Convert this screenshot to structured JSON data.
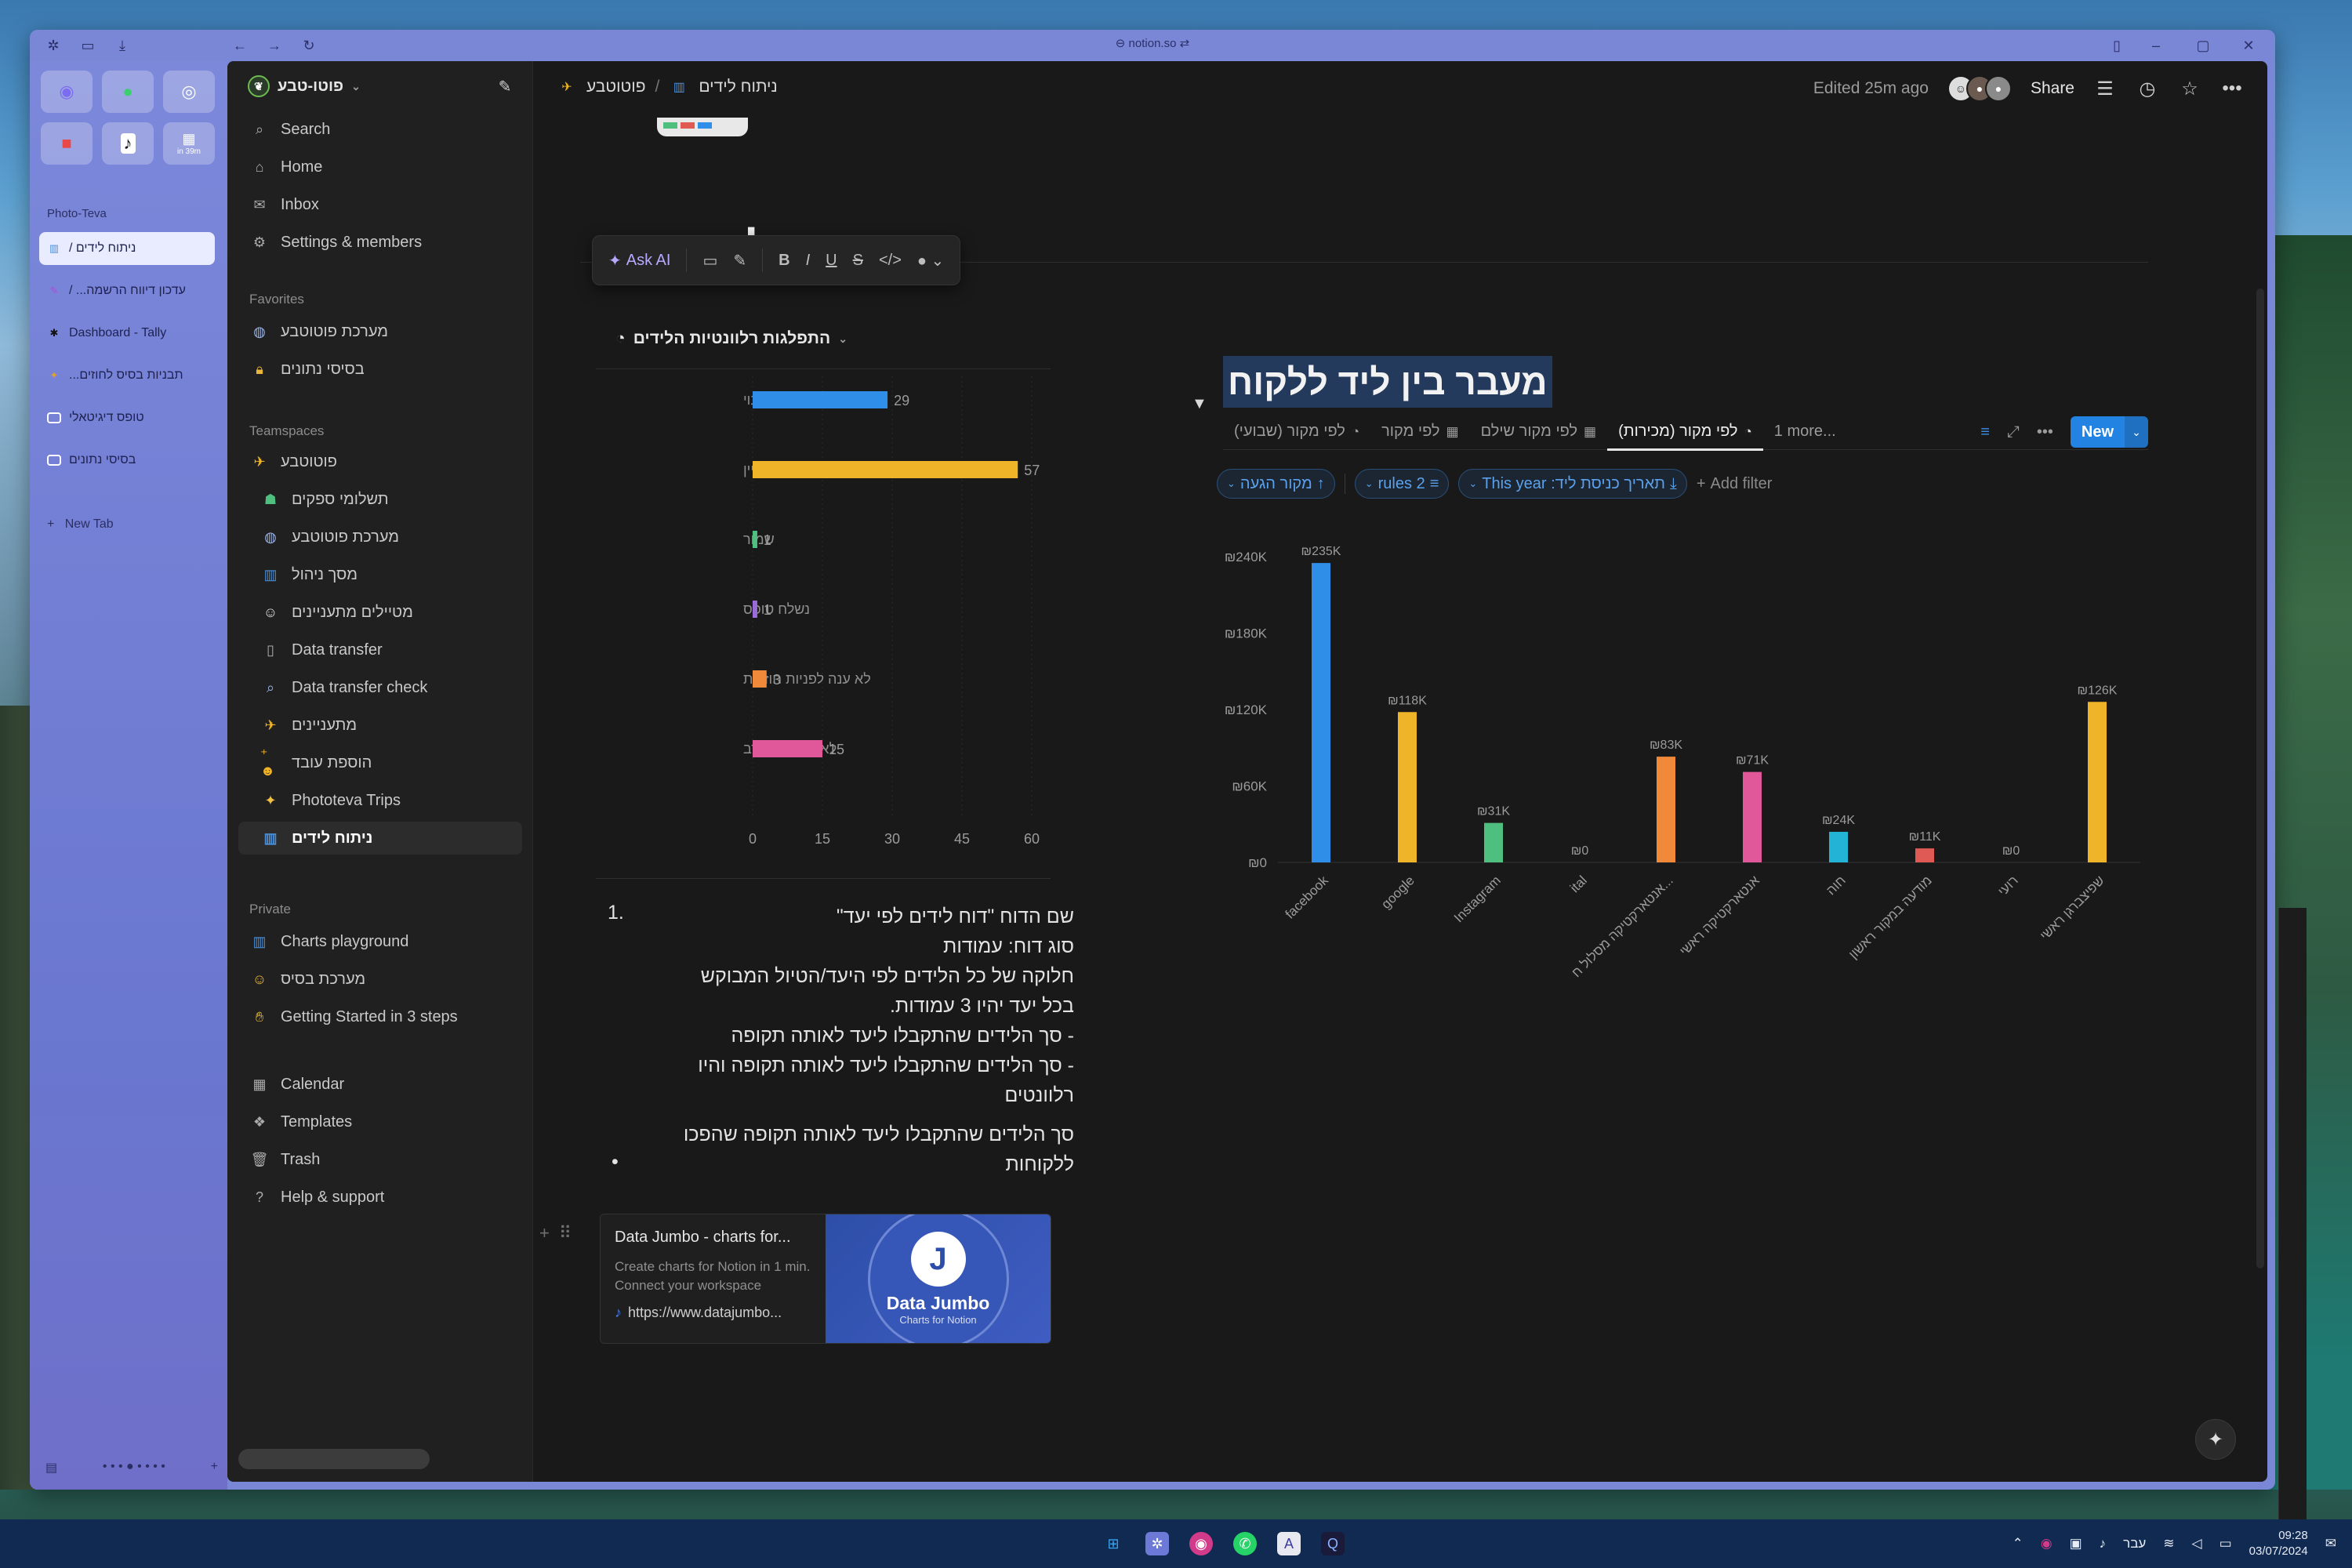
{
  "browser": {
    "url": "notion.so",
    "space_label": "Photo-Teva",
    "tabs": [
      {
        "label": "ניתוח לידים /",
        "icon": "chart-icon",
        "active": true
      },
      {
        "label": "עדכון דיווח הרשמה... /",
        "icon": "page-icon",
        "active": false
      },
      {
        "label": "Dashboard - Tally",
        "icon": "tally-icon",
        "active": false
      },
      {
        "label": "תבניות בסיס לחוזים...",
        "icon": "template-icon",
        "active": false
      },
      {
        "label": "טופס דיגיטאלי",
        "icon": "form-icon",
        "active": false
      },
      {
        "label": "בסיסי נתונים",
        "icon": "form-icon",
        "active": false
      }
    ],
    "new_tab_label": "New Tab",
    "pin_badge": "in 39m"
  },
  "sidebar": {
    "workspace": "פוטו-טבע",
    "top_items": [
      {
        "label": "Search",
        "icon": "search-icon"
      },
      {
        "label": "Home",
        "icon": "home-icon"
      },
      {
        "label": "Inbox",
        "icon": "inbox-icon"
      },
      {
        "label": "Settings & members",
        "icon": "gear-icon"
      }
    ],
    "favorites_label": "Favorites",
    "favorites": [
      {
        "label": "מערכת פוטוטבע",
        "icon": "globe-icon"
      },
      {
        "label": "בסיסי נתונים",
        "icon": "lock-icon"
      }
    ],
    "teamspaces_label": "Teamspaces",
    "teamspaces": [
      {
        "label": "פוטוטבע",
        "icon": "rocket-icon"
      },
      {
        "label": "תשלומי ספקים",
        "icon": "money-icon"
      },
      {
        "label": "מערכת פוטוטבע",
        "icon": "globe-icon"
      },
      {
        "label": "מסך ניהול",
        "icon": "chart-icon"
      },
      {
        "label": "מטיילים מתעניינים",
        "icon": "person-icon"
      },
      {
        "label": "Data transfer",
        "icon": "doc-icon"
      },
      {
        "label": "Data transfer check",
        "icon": "magnifier-icon"
      },
      {
        "label": "מתעניינים",
        "icon": "rocket-icon"
      },
      {
        "label": "הוספת עובד",
        "icon": "add-person-icon"
      },
      {
        "label": "Phototeva Trips",
        "icon": "sparkle-icon"
      },
      {
        "label": "ניתוח לידים",
        "icon": "chart-icon",
        "selected": true
      }
    ],
    "private_label": "Private",
    "private": [
      {
        "label": "Charts playground",
        "icon": "chart-icon"
      },
      {
        "label": "מערכת בסיס",
        "icon": "person-icon"
      },
      {
        "label": "Getting Started in 3 steps",
        "icon": "wave-icon"
      }
    ],
    "bottom": [
      {
        "label": "Calendar",
        "icon": "calendar-icon"
      },
      {
        "label": "Templates",
        "icon": "templates-icon"
      },
      {
        "label": "Trash",
        "icon": "trash-icon"
      },
      {
        "label": "Help & support",
        "icon": "help-icon"
      }
    ]
  },
  "topbar": {
    "crumb_parent": "פוטוטבע",
    "crumb_sep": "/",
    "crumb_current": "ניתוח לידים",
    "edited": "Edited 25m ago",
    "share": "Share"
  },
  "page": {
    "title": "ניתוח לידים"
  },
  "format_bar": {
    "ask_ai": "Ask AI"
  },
  "left_chart": {
    "title": "התפלגות רלוונטיות הלידים"
  },
  "doc": {
    "number": "1.",
    "lines": [
      "שם הדוח \"דוח לידים לפי יעד\"",
      "סוג דוח: עמודות",
      "חלוקה של כל הלידים לפי היעד/הטיול המבוקש",
      "בכל יעד יהיו 3 עמודות.",
      "- סך הלידים שהתקבלו ליעד לאותה תקופה",
      "- סך הלידים שהתקבלו ליעד לאותה תקופה והיו רלוונטים"
    ],
    "bullet": "סך הלידים שהתקבלו ליעד לאותה תקופה שהפכו ללקוחות"
  },
  "bookmark": {
    "title": "Data Jumbo - charts for...",
    "desc": "Create charts for Notion in 1 min. Connect your workspace",
    "url": "https://www.datajumbo...",
    "brand": "Data Jumbo",
    "brand_sub": "Charts for Notion"
  },
  "database": {
    "title": "מעבר בין ליד ללקוח",
    "views": [
      {
        "label": "לפי מקור (שבועי)",
        "icon": "pie-icon"
      },
      {
        "label": "לפי מקור",
        "icon": "table-icon"
      },
      {
        "label": "לפי מקור שילם",
        "icon": "table-icon"
      },
      {
        "label": "לפי מקור (מכירות)",
        "icon": "pie-icon",
        "active": true
      }
    ],
    "more_views": "1 more...",
    "new_label": "New",
    "filters": [
      {
        "label": "מקור הגעה",
        "icon": "sort-up-icon"
      },
      {
        "label": "2 rules",
        "icon": "filter-icon"
      },
      {
        "label": "תאריך כניסת ליד: This year",
        "icon": "download-icon"
      }
    ],
    "add_filter": "Add filter"
  },
  "taskbar": {
    "lang": "עבר",
    "time": "09:28",
    "date": "03/07/2024"
  },
  "chart_data": [
    {
      "type": "bar",
      "orientation": "horizontal",
      "title": "התפלגות רלוונטיות הלידים",
      "categories": [
        "פנוי",
        "מתעניין",
        "שמור",
        "נשלח טופס",
        "לא ענה לפניות חוזרות",
        "לא רלוונטי/סירב"
      ],
      "values": [
        29,
        57,
        1,
        1,
        3,
        15
      ],
      "colors": [
        "#2f8ee8",
        "#f0b429",
        "#4fbf7f",
        "#9b6bdc",
        "#f08a3a",
        "#e0589a"
      ],
      "xlim": [
        0,
        60
      ],
      "xticks": [
        "0",
        "15",
        "30",
        "45",
        "60"
      ],
      "grid": true
    },
    {
      "type": "bar",
      "orientation": "vertical",
      "title": "מעבר בין ליד ללקוח",
      "categories": [
        "facebook",
        "google",
        "Instagram",
        "ital",
        "אנטארקטיקה מסלול ח...",
        "אנטארקטיקה ראשי",
        "חוה",
        "מודעה במקור ראשון",
        "רועי",
        "שפיצברגן ראשי"
      ],
      "values": [
        235000,
        118000,
        31000,
        0,
        83000,
        71000,
        24000,
        11000,
        0,
        126000
      ],
      "value_labels": [
        "₪235K",
        "₪118K",
        "₪31K",
        "₪0",
        "₪83K",
        "₪71K",
        "₪24K",
        "₪11K",
        "₪0",
        "₪126K"
      ],
      "colors": [
        "#2f8ee8",
        "#f0b429",
        "#4fbf7f",
        "#9b6bdc",
        "#f08a3a",
        "#e0589a",
        "#22b3d6",
        "#e05a55",
        "#8a8a8a",
        "#f0b429"
      ],
      "ylim": [
        0,
        240000
      ],
      "yticks": [
        "₪0",
        "₪60K",
        "₪120K",
        "₪180K",
        "₪240K"
      ],
      "grid": false
    }
  ]
}
